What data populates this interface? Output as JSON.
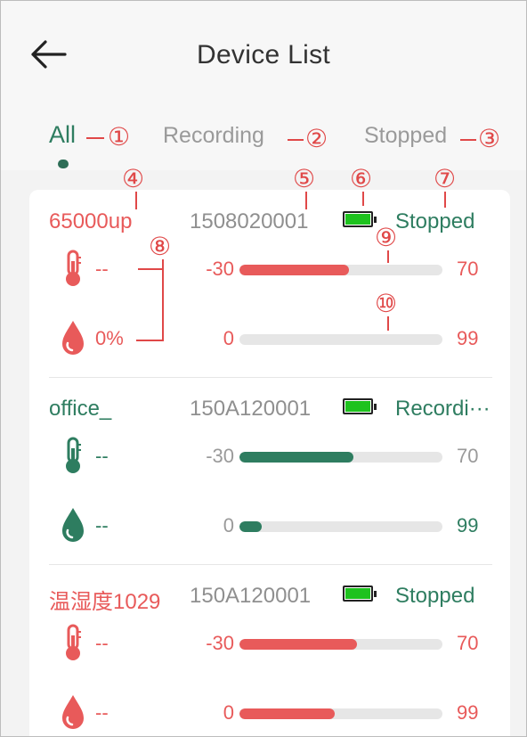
{
  "header": {
    "title": "Device List",
    "back_icon": "arrow-left-icon"
  },
  "tabs": [
    {
      "label": "All",
      "active": true
    },
    {
      "label": "Recording",
      "active": false
    },
    {
      "label": "Stopped",
      "active": false
    }
  ],
  "annotations": [
    "①",
    "②",
    "③",
    "④",
    "⑤",
    "⑥",
    "⑦",
    "⑧",
    "⑨",
    "⑩"
  ],
  "colors": {
    "green": "#2e7d60",
    "red": "#e85a5a",
    "gray": "#9a9a9a",
    "battery": "#1ec21e"
  },
  "devices": [
    {
      "name": "65000up",
      "serial": "1508020001",
      "status": "Stopped",
      "accent": "red",
      "temp": {
        "value": "--",
        "min": "-30",
        "max": "70",
        "fill_fraction": 0.54
      },
      "humidity": {
        "value": "0%",
        "min": "0",
        "max": "99",
        "fill_fraction": 0.0
      }
    },
    {
      "name": "office_",
      "serial": "150A120001",
      "status": "Recordi···",
      "accent": "green",
      "temp": {
        "value": "--",
        "min": "-30",
        "max": "70",
        "fill_fraction": 0.56
      },
      "humidity": {
        "value": "--",
        "min": "0",
        "max": "99",
        "fill_fraction": 0.11
      }
    },
    {
      "name": "温湿度1029",
      "serial": "150A120001",
      "status": "Stopped",
      "accent": "red",
      "temp": {
        "value": "--",
        "min": "-30",
        "max": "70",
        "fill_fraction": 0.58
      },
      "humidity": {
        "value": "--",
        "min": "0",
        "max": "99",
        "fill_fraction": 0.47
      }
    }
  ]
}
